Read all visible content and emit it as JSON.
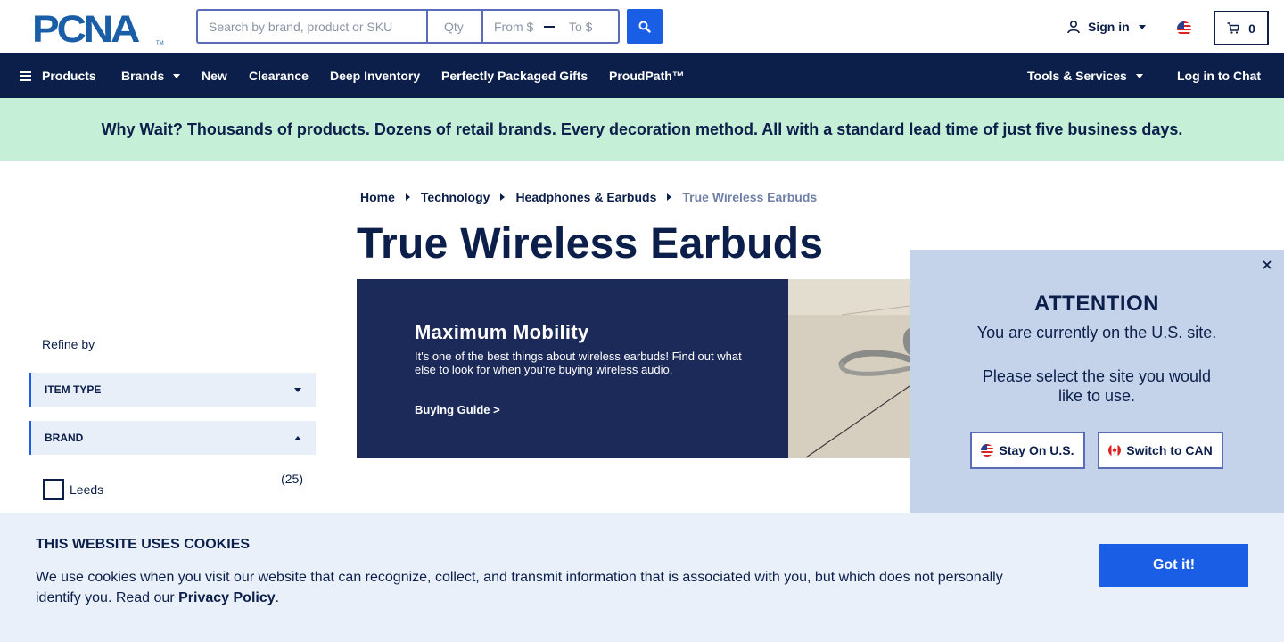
{
  "brand": {
    "logo_text": "PCNA",
    "trademark": "TM"
  },
  "search": {
    "placeholder": "Search by brand, product or SKU",
    "qty_placeholder": "Qty",
    "from_placeholder": "From $",
    "to_placeholder": "To $"
  },
  "account": {
    "signin_label": "Sign in",
    "cart_count": "0"
  },
  "nav": {
    "products": "Products",
    "brands": "Brands",
    "new": "New",
    "clearance": "Clearance",
    "deep_inventory": "Deep Inventory",
    "packaged_gifts": "Perfectly Packaged Gifts",
    "proudpath": "ProudPath™",
    "tools": "Tools & Services",
    "chat": "Log in to Chat"
  },
  "promo": {
    "text": "Why Wait? Thousands of products. Dozens of retail brands. Every decoration method. All with a standard lead time of just five business days."
  },
  "breadcrumb": [
    "Home",
    "Technology",
    "Headphones & Earbuds",
    "True Wireless Earbuds"
  ],
  "page": {
    "title": "True Wireless Earbuds"
  },
  "banner": {
    "heading": "Maximum Mobility",
    "text": "It's one of the best things about wireless earbuds! Find out what else to look for when you're buying wireless audio.",
    "link": "Buying Guide >"
  },
  "filters": {
    "refine_label": "Refine by",
    "item_type": "ITEM TYPE",
    "brand": "BRAND",
    "options": [
      {
        "label": "Leeds",
        "count": "(25)"
      }
    ]
  },
  "site_modal": {
    "title": "ATTENTION",
    "line1": "You are currently on the U.S. site.",
    "line2": "Please select the site you would like to use.",
    "stay_label": "Stay On U.S.",
    "switch_label": "Switch to CAN"
  },
  "cookie": {
    "title": "THIS WEBSITE USES COOKIES",
    "text": "We use cookies when you visit our website that can recognize, collect, and transmit information that is associated with you, but which does not personally identify you. Read our",
    "link": "Privacy Policy",
    "period": ".",
    "button": "Got it!"
  },
  "colors": {
    "navy": "#0b1f4a",
    "accent_blue": "#1a5ee6",
    "promo_green": "#c6efd7",
    "modal_blue": "#c5d3ea",
    "cookie_bg": "#e9f0fa"
  }
}
